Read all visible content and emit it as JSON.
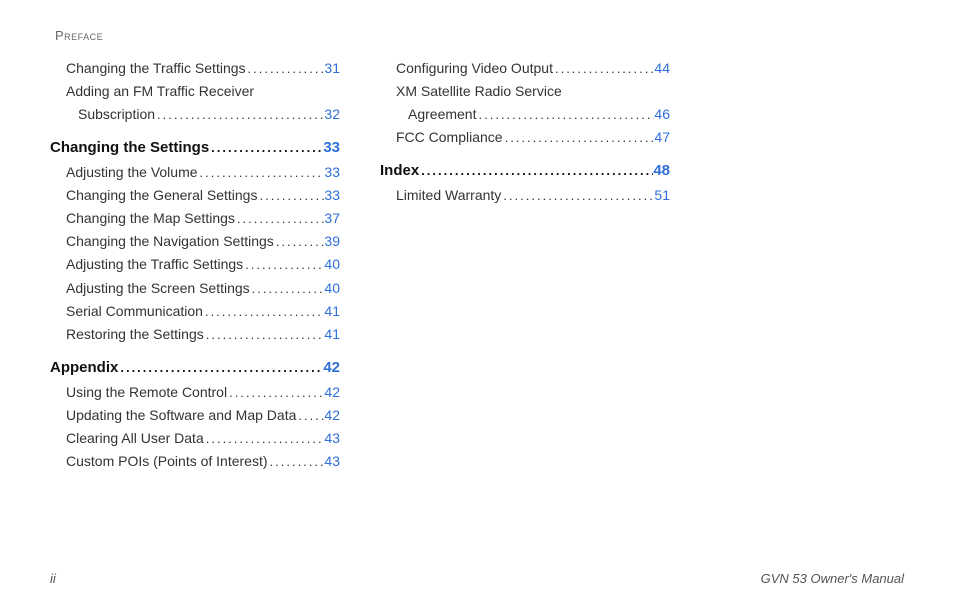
{
  "header": "Preface",
  "col1": [
    {
      "label": "Changing the Traffic Settings",
      "page": "31",
      "class": "sub"
    },
    {
      "label": "Adding an FM Traffic Receiver",
      "page": "",
      "class": "sub",
      "nodots": true
    },
    {
      "label": "Subscription",
      "page": "32",
      "class": "subsub"
    },
    {
      "label": "Changing the Settings",
      "page": "33",
      "class": "section-head",
      "space": true
    },
    {
      "label": "Adjusting the Volume",
      "page": "33",
      "class": "sub"
    },
    {
      "label": "Changing the General Settings",
      "page": "33",
      "class": "sub"
    },
    {
      "label": "Changing the Map Settings",
      "page": "37",
      "class": "sub"
    },
    {
      "label": "Changing the Navigation Settings",
      "page": "39",
      "class": "sub"
    },
    {
      "label": "Adjusting the Traffic Settings",
      "page": "40",
      "class": "sub"
    },
    {
      "label": "Adjusting the Screen Settings",
      "page": "40",
      "class": "sub"
    },
    {
      "label": "Serial Communication",
      "page": "41",
      "class": "sub"
    },
    {
      "label": "Restoring the Settings",
      "page": "41",
      "class": "sub"
    },
    {
      "label": "Appendix",
      "page": "42",
      "class": "section-head",
      "space": true
    },
    {
      "label": "Using the Remote Control",
      "page": "42",
      "class": "sub"
    },
    {
      "label": "Updating the Software and Map Data",
      "page": "42",
      "class": "sub"
    },
    {
      "label": "Clearing All User Data",
      "page": "43",
      "class": "sub"
    },
    {
      "label": "Custom POIs (Points of Interest)",
      "page": "43",
      "class": "sub"
    }
  ],
  "col2": [
    {
      "label": "Configuring Video Output",
      "page": "44",
      "class": "sub"
    },
    {
      "label": "XM Satellite Radio Service",
      "page": "",
      "class": "sub",
      "nodots": true
    },
    {
      "label": "Agreement",
      "page": "46",
      "class": "subsub"
    },
    {
      "label": "FCC Compliance",
      "page": "47",
      "class": "sub"
    },
    {
      "label": "Index",
      "page": "48",
      "class": "section-head",
      "space": true
    },
    {
      "label": "Limited Warranty",
      "page": "51",
      "class": "sub"
    }
  ],
  "footer": {
    "left": "ii",
    "right": "GVN 53 Owner's Manual"
  }
}
